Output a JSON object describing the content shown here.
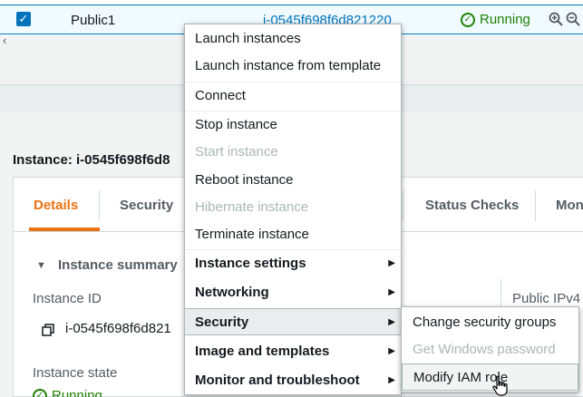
{
  "table_row": {
    "name": "Public1",
    "instance_id": "i-0545f698f6d821220",
    "state": "Running",
    "status_check_mark": "✓",
    "checkbox_mark": "✓",
    "zoom_in_icon": "zoom-in-icon",
    "zoom_out_icon": "zoom-out-icon"
  },
  "scrollbar": {
    "left_arrow": "‹"
  },
  "details": {
    "title": "Instance: i-0545f698f6d8",
    "tabs": [
      {
        "label": "Details",
        "active": true
      },
      {
        "label": "Security",
        "active": false
      },
      {
        "label": "Status Checks",
        "active": false
      },
      {
        "label": "Mon",
        "active": false
      }
    ],
    "summary_label": "Instance summary",
    "summary_caret": "▼",
    "instance_id_label": "Instance ID",
    "instance_id_value": "i-0545f698f6d821",
    "public_ipv4_label": "Public IPv4",
    "instance_state_label": "Instance state",
    "instance_state_value": "Running"
  },
  "context_menu": {
    "items": [
      {
        "label": "Launch instances",
        "disabled": false,
        "bold": false,
        "submenu": false
      },
      {
        "label": "Launch instance from template",
        "disabled": false,
        "bold": false,
        "submenu": false
      },
      {
        "label": "Connect",
        "disabled": false,
        "bold": false,
        "submenu": false
      },
      {
        "label": "Stop instance",
        "disabled": false,
        "bold": false,
        "submenu": false
      },
      {
        "label": "Start instance",
        "disabled": true,
        "bold": false,
        "submenu": false
      },
      {
        "label": "Reboot instance",
        "disabled": false,
        "bold": false,
        "submenu": false
      },
      {
        "label": "Hibernate instance",
        "disabled": true,
        "bold": false,
        "submenu": false
      },
      {
        "label": "Terminate instance",
        "disabled": false,
        "bold": false,
        "submenu": false
      },
      {
        "label": "Instance settings",
        "disabled": false,
        "bold": true,
        "submenu": true
      },
      {
        "label": "Networking",
        "disabled": false,
        "bold": true,
        "submenu": true
      },
      {
        "label": "Security",
        "disabled": false,
        "bold": true,
        "submenu": true,
        "hovered": true
      },
      {
        "label": "Image and templates",
        "disabled": false,
        "bold": true,
        "submenu": true
      },
      {
        "label": "Monitor and troubleshoot",
        "disabled": false,
        "bold": true,
        "submenu": true
      }
    ],
    "submenu_arrow": "▶"
  },
  "security_submenu": {
    "items": [
      {
        "label": "Change security groups",
        "disabled": false
      },
      {
        "label": "Get Windows password",
        "disabled": true
      },
      {
        "label": "Modify IAM role",
        "disabled": false,
        "hovered": true
      }
    ]
  },
  "colors": {
    "accent_orange": "#ec7211",
    "link_blue": "#0073bb",
    "running_green": "#1d8102",
    "disabled_gray": "#aab7b8"
  }
}
